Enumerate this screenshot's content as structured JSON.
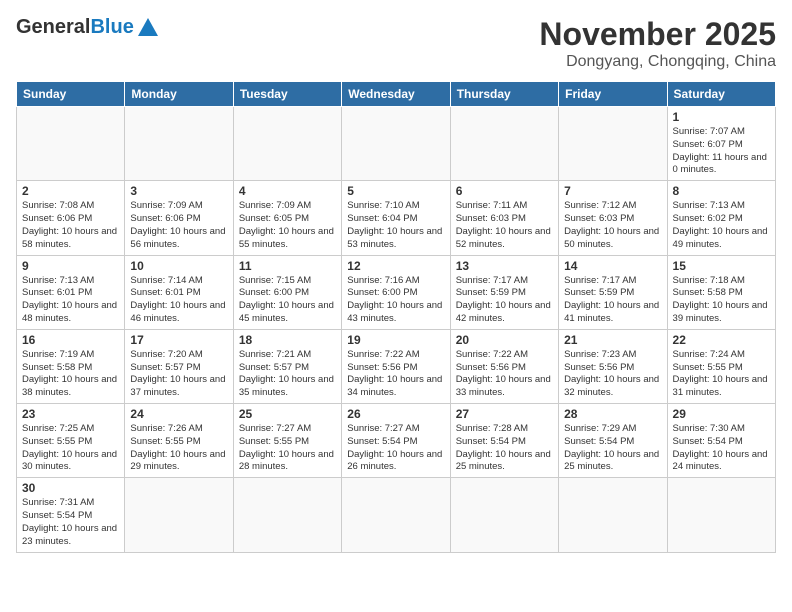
{
  "logo": {
    "general": "General",
    "blue": "Blue"
  },
  "title": {
    "month_year": "November 2025",
    "location": "Dongyang, Chongqing, China"
  },
  "weekdays": [
    "Sunday",
    "Monday",
    "Tuesday",
    "Wednesday",
    "Thursday",
    "Friday",
    "Saturday"
  ],
  "weeks": [
    [
      {
        "day": "",
        "info": ""
      },
      {
        "day": "",
        "info": ""
      },
      {
        "day": "",
        "info": ""
      },
      {
        "day": "",
        "info": ""
      },
      {
        "day": "",
        "info": ""
      },
      {
        "day": "",
        "info": ""
      },
      {
        "day": "1",
        "info": "Sunrise: 7:07 AM\nSunset: 6:07 PM\nDaylight: 11 hours and 0 minutes."
      }
    ],
    [
      {
        "day": "2",
        "info": "Sunrise: 7:08 AM\nSunset: 6:06 PM\nDaylight: 10 hours and 58 minutes."
      },
      {
        "day": "3",
        "info": "Sunrise: 7:09 AM\nSunset: 6:06 PM\nDaylight: 10 hours and 56 minutes."
      },
      {
        "day": "4",
        "info": "Sunrise: 7:09 AM\nSunset: 6:05 PM\nDaylight: 10 hours and 55 minutes."
      },
      {
        "day": "5",
        "info": "Sunrise: 7:10 AM\nSunset: 6:04 PM\nDaylight: 10 hours and 53 minutes."
      },
      {
        "day": "6",
        "info": "Sunrise: 7:11 AM\nSunset: 6:03 PM\nDaylight: 10 hours and 52 minutes."
      },
      {
        "day": "7",
        "info": "Sunrise: 7:12 AM\nSunset: 6:03 PM\nDaylight: 10 hours and 50 minutes."
      },
      {
        "day": "8",
        "info": "Sunrise: 7:13 AM\nSunset: 6:02 PM\nDaylight: 10 hours and 49 minutes."
      }
    ],
    [
      {
        "day": "9",
        "info": "Sunrise: 7:13 AM\nSunset: 6:01 PM\nDaylight: 10 hours and 48 minutes."
      },
      {
        "day": "10",
        "info": "Sunrise: 7:14 AM\nSunset: 6:01 PM\nDaylight: 10 hours and 46 minutes."
      },
      {
        "day": "11",
        "info": "Sunrise: 7:15 AM\nSunset: 6:00 PM\nDaylight: 10 hours and 45 minutes."
      },
      {
        "day": "12",
        "info": "Sunrise: 7:16 AM\nSunset: 6:00 PM\nDaylight: 10 hours and 43 minutes."
      },
      {
        "day": "13",
        "info": "Sunrise: 7:17 AM\nSunset: 5:59 PM\nDaylight: 10 hours and 42 minutes."
      },
      {
        "day": "14",
        "info": "Sunrise: 7:17 AM\nSunset: 5:59 PM\nDaylight: 10 hours and 41 minutes."
      },
      {
        "day": "15",
        "info": "Sunrise: 7:18 AM\nSunset: 5:58 PM\nDaylight: 10 hours and 39 minutes."
      }
    ],
    [
      {
        "day": "16",
        "info": "Sunrise: 7:19 AM\nSunset: 5:58 PM\nDaylight: 10 hours and 38 minutes."
      },
      {
        "day": "17",
        "info": "Sunrise: 7:20 AM\nSunset: 5:57 PM\nDaylight: 10 hours and 37 minutes."
      },
      {
        "day": "18",
        "info": "Sunrise: 7:21 AM\nSunset: 5:57 PM\nDaylight: 10 hours and 35 minutes."
      },
      {
        "day": "19",
        "info": "Sunrise: 7:22 AM\nSunset: 5:56 PM\nDaylight: 10 hours and 34 minutes."
      },
      {
        "day": "20",
        "info": "Sunrise: 7:22 AM\nSunset: 5:56 PM\nDaylight: 10 hours and 33 minutes."
      },
      {
        "day": "21",
        "info": "Sunrise: 7:23 AM\nSunset: 5:56 PM\nDaylight: 10 hours and 32 minutes."
      },
      {
        "day": "22",
        "info": "Sunrise: 7:24 AM\nSunset: 5:55 PM\nDaylight: 10 hours and 31 minutes."
      }
    ],
    [
      {
        "day": "23",
        "info": "Sunrise: 7:25 AM\nSunset: 5:55 PM\nDaylight: 10 hours and 30 minutes."
      },
      {
        "day": "24",
        "info": "Sunrise: 7:26 AM\nSunset: 5:55 PM\nDaylight: 10 hours and 29 minutes."
      },
      {
        "day": "25",
        "info": "Sunrise: 7:27 AM\nSunset: 5:55 PM\nDaylight: 10 hours and 28 minutes."
      },
      {
        "day": "26",
        "info": "Sunrise: 7:27 AM\nSunset: 5:54 PM\nDaylight: 10 hours and 26 minutes."
      },
      {
        "day": "27",
        "info": "Sunrise: 7:28 AM\nSunset: 5:54 PM\nDaylight: 10 hours and 25 minutes."
      },
      {
        "day": "28",
        "info": "Sunrise: 7:29 AM\nSunset: 5:54 PM\nDaylight: 10 hours and 25 minutes."
      },
      {
        "day": "29",
        "info": "Sunrise: 7:30 AM\nSunset: 5:54 PM\nDaylight: 10 hours and 24 minutes."
      }
    ],
    [
      {
        "day": "30",
        "info": "Sunrise: 7:31 AM\nSunset: 5:54 PM\nDaylight: 10 hours and 23 minutes."
      },
      {
        "day": "",
        "info": ""
      },
      {
        "day": "",
        "info": ""
      },
      {
        "day": "",
        "info": ""
      },
      {
        "day": "",
        "info": ""
      },
      {
        "day": "",
        "info": ""
      },
      {
        "day": "",
        "info": ""
      }
    ]
  ]
}
